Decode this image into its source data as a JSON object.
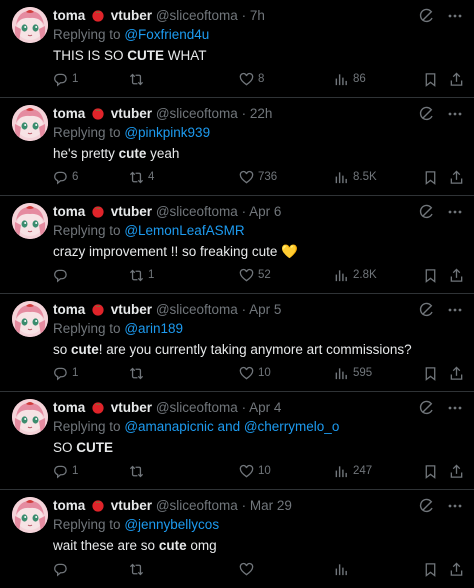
{
  "colors": {
    "background": "#000000",
    "text": "#e7e9ea",
    "muted": "#71767b",
    "link": "#1d9bf0",
    "divider": "#2f3336"
  },
  "author": {
    "name": "toma",
    "vtuber": "vtuber",
    "handle": "@sliceoftoma"
  },
  "replies": [
    {
      "time": "7h",
      "replying_label": "Replying to",
      "replying_to": "@Foxfriend4u",
      "replying_extra": "",
      "text_parts": [
        {
          "t": "THIS IS SO "
        },
        {
          "t": "CUTE",
          "b": true
        },
        {
          "t": " WHAT"
        }
      ],
      "stats": {
        "replies": "1",
        "retweets": "",
        "likes": "8",
        "views": "86"
      }
    },
    {
      "time": "22h",
      "replying_label": "Replying to",
      "replying_to": "@pinkpink939",
      "replying_extra": "",
      "text_parts": [
        {
          "t": "he's pretty "
        },
        {
          "t": "cute",
          "b": true
        },
        {
          "t": " yeah"
        }
      ],
      "stats": {
        "replies": "6",
        "retweets": "4",
        "likes": "736",
        "views": "8.5K"
      }
    },
    {
      "time": "Apr 6",
      "replying_label": "Replying to",
      "replying_to": "@LemonLeafASMR",
      "replying_extra": "",
      "text_parts": [
        {
          "t": "crazy improvement !! so freaking cute "
        },
        {
          "t": "💛",
          "emoji": "yellow-heart-emoji"
        }
      ],
      "stats": {
        "replies": "",
        "retweets": "1",
        "likes": "52",
        "views": "2.8K"
      }
    },
    {
      "time": "Apr 5",
      "replying_label": "Replying to",
      "replying_to": "@arin189",
      "replying_extra": "",
      "text_parts": [
        {
          "t": "so "
        },
        {
          "t": "cute",
          "b": true
        },
        {
          "t": "! are you currently taking anymore art commissions?"
        }
      ],
      "stats": {
        "replies": "1",
        "retweets": "",
        "likes": "10",
        "views": "595"
      }
    },
    {
      "time": "Apr 4",
      "replying_label": "Replying to",
      "replying_to": "@amanapicnic and @cherrymelo_o",
      "replying_extra": "",
      "text_parts": [
        {
          "t": "SO "
        },
        {
          "t": "CUTE",
          "b": true
        }
      ],
      "stats": {
        "replies": "1",
        "retweets": "",
        "likes": "10",
        "views": "247"
      }
    },
    {
      "time": "Mar 29",
      "replying_label": "Replying to",
      "replying_to": "@jennybellycos",
      "replying_extra": "",
      "text_parts": [
        {
          "t": "wait these are so "
        },
        {
          "t": "cute",
          "b": true
        },
        {
          "t": " omg"
        }
      ],
      "stats": {
        "replies": "",
        "retweets": "",
        "likes": "",
        "views": ""
      }
    }
  ],
  "icons": {
    "reply": "reply-icon",
    "retweet": "retweet-icon",
    "like": "heart-icon",
    "views": "views-icon",
    "bookmark": "bookmark-icon",
    "share": "share-icon",
    "grok": "grok-icon",
    "more": "more-icon"
  }
}
